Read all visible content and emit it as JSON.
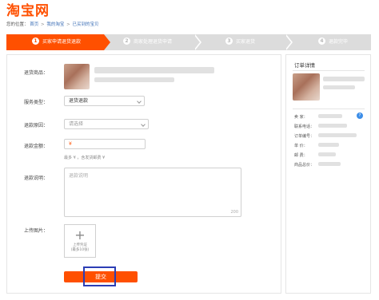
{
  "header": {
    "logo_text": "淘宝网"
  },
  "breadcrumb": {
    "prefix": "您的位置：",
    "items": [
      "首页",
      "我的淘宝",
      "已买到的宝贝"
    ],
    "separator": ">"
  },
  "steps": [
    {
      "num": "1",
      "label": "买家申请退货退款",
      "active": true
    },
    {
      "num": "2",
      "label": "商家处理退货申请",
      "active": false
    },
    {
      "num": "3",
      "label": "买家退货",
      "active": false
    },
    {
      "num": "4",
      "label": "退款完毕",
      "active": false
    }
  ],
  "form": {
    "product_label": "退货商品：",
    "service_type_label": "服务类型：",
    "service_type_value": "退货退款",
    "reason_label": "退款原因：",
    "reason_placeholder": "请选择",
    "amount_label": "退款金额：",
    "amount_currency": "¥",
    "amount_hint": "最多 ¥ ，含发货邮费 ¥",
    "description_label": "退款说明：",
    "description_placeholder": "退款说明",
    "description_counter": "200",
    "upload_label": "上传图片：",
    "upload_plus": "+",
    "upload_text": "上传凭证",
    "upload_limit": "(最多10张)",
    "submit_label": "提交"
  },
  "order_details": {
    "title": "订单详情",
    "fields": [
      "卖      家：",
      "联系电话：",
      "订单编号：",
      "单      价：",
      "邮      费：",
      "商品总价："
    ],
    "info_icon_glyph": "?"
  },
  "colors": {
    "brand": "#ff5000",
    "step_inactive": "#dcdcdc",
    "highlight": "#2c3eb5",
    "link": "#3d6fb6"
  }
}
